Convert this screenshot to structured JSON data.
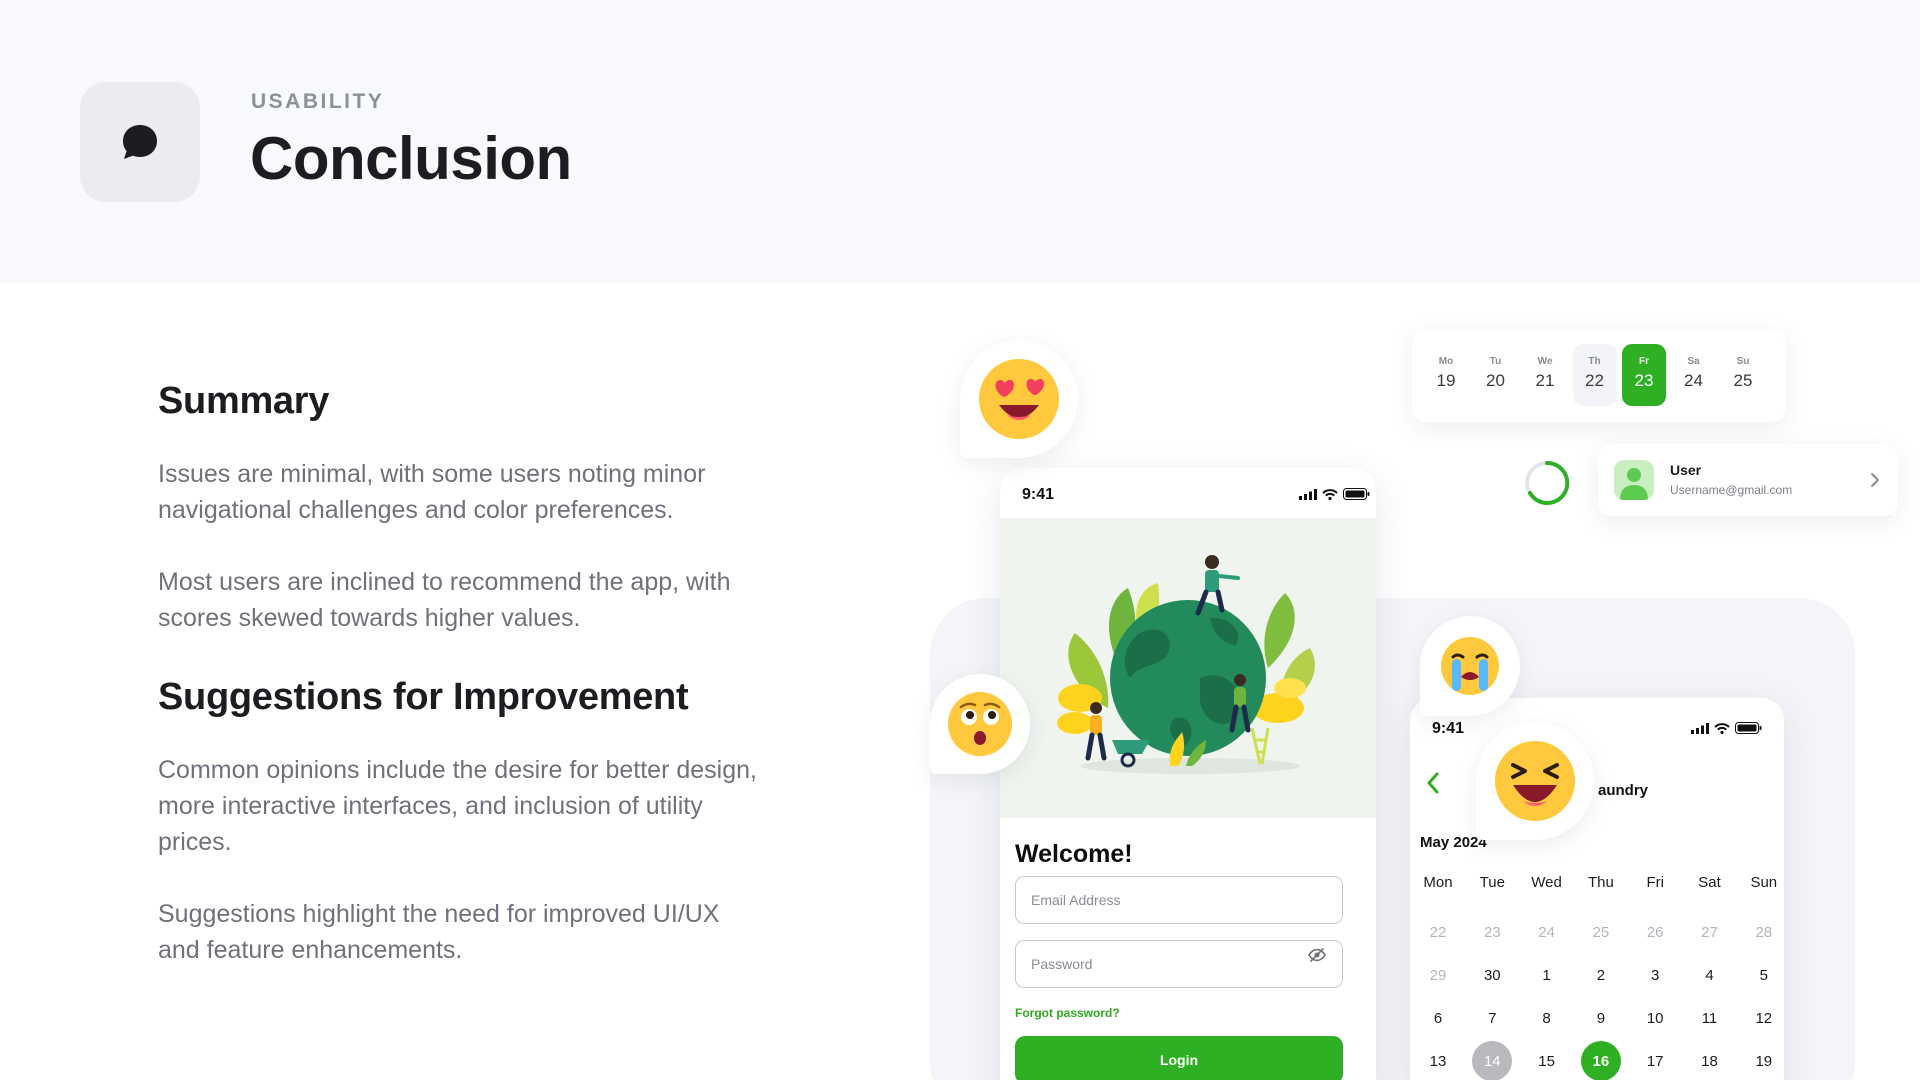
{
  "header": {
    "icon": "chat-bubble-icon",
    "eyebrow": "USABILITY",
    "title": "Conclusion"
  },
  "summary": {
    "title": "Summary",
    "p1": "Issues are minimal, with some users noting minor navigational challenges and color preferences.",
    "p2": "Most users are inclined to recommend the app, with scores skewed towards higher values."
  },
  "suggestions": {
    "title": "Suggestions for Improvement",
    "p1": "Common opinions include the desire for better design, more interactive interfaces, and inclusion of utility prices.",
    "p2": "Suggestions highlight the need for improved UI/UX and feature enhancements."
  },
  "login_phone": {
    "time": "9:41",
    "status_icons": [
      "cellular-signal-icon",
      "wifi-icon",
      "battery-icon"
    ],
    "illustration": "earth-gardening-illustration",
    "welcome": "Welcome!",
    "email_placeholder": "Email Address",
    "password_placeholder": "Password",
    "eye_icon": "eye-off-icon",
    "forgot": "Forgot password?",
    "login_label": "Login"
  },
  "week_strip": {
    "days": [
      {
        "label": "Mo",
        "num": "19"
      },
      {
        "label": "Tu",
        "num": "20"
      },
      {
        "label": "We",
        "num": "21"
      },
      {
        "label": "Th",
        "num": "22"
      },
      {
        "label": "Fr",
        "num": "23"
      },
      {
        "label": "Sa",
        "num": "24"
      },
      {
        "label": "Su",
        "num": "25"
      }
    ],
    "selected_index": 4,
    "hover_index": 3
  },
  "user_card": {
    "name": "User",
    "email": "Username@gmail.com",
    "avatar_icon": "user-avatar-icon",
    "chevron_icon": "chevron-right-icon"
  },
  "calendar_phone": {
    "time": "9:41",
    "title_fragment": "aundry",
    "back_icon": "chevron-left-icon",
    "month": "May 2024",
    "weekdays": [
      "Mon",
      "Tue",
      "Wed",
      "Thu",
      "Fri",
      "Sat",
      "Sun"
    ],
    "weeks": [
      [
        "22",
        "23",
        "24",
        "25",
        "26",
        "27",
        "28"
      ],
      [
        "29",
        "30",
        "1",
        "2",
        "3",
        "4",
        "5"
      ],
      [
        "6",
        "7",
        "8",
        "9",
        "10",
        "11",
        "12"
      ],
      [
        "13",
        "14",
        "15",
        "16",
        "17",
        "18",
        "19"
      ]
    ],
    "muted_cells": [
      "0-0",
      "0-1",
      "0-2",
      "0-3",
      "0-4",
      "0-5",
      "0-6",
      "1-0"
    ],
    "grey_cell": "3-1",
    "selected_cell": "3-3"
  },
  "emojis": [
    "heart-eyes-emoji-icon",
    "flushed-emoji-icon",
    "crying-emoji-icon",
    "laughing-emoji-icon"
  ],
  "colors": {
    "accent": "#2fb024",
    "header_bg": "#f8f9fc",
    "text_primary": "#1c1d21",
    "text_secondary": "#6f717b"
  }
}
